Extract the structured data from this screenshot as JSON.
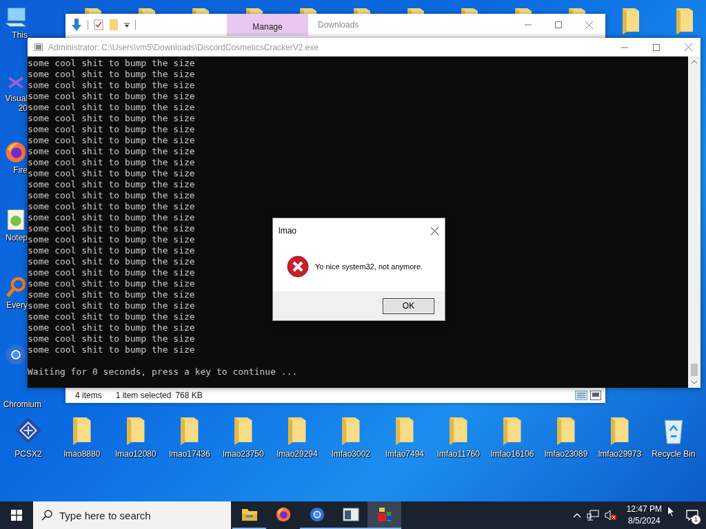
{
  "desktop": {
    "icons_top": [
      {
        "kind": "folder"
      },
      {
        "kind": "folder"
      },
      {
        "kind": "folder"
      },
      {
        "kind": "folder"
      },
      {
        "kind": "folder"
      },
      {
        "kind": "folder"
      },
      {
        "kind": "folder"
      },
      {
        "kind": "folder"
      },
      {
        "kind": "folder"
      },
      {
        "kind": "folder"
      },
      {
        "kind": "folder"
      },
      {
        "kind": "folder"
      }
    ],
    "icons_left": [
      {
        "kind": "computer",
        "label": "This"
      },
      {
        "kind": "visual-studio",
        "label": "Visual\n20"
      },
      {
        "kind": "firefox",
        "label": "Fire"
      },
      {
        "kind": "notepad",
        "label": "Notep"
      },
      {
        "kind": "everything",
        "label": "Every"
      },
      {
        "kind": "chromium",
        "label": "Chromium"
      }
    ],
    "icons_bottom": [
      {
        "kind": "pcsx2",
        "label": "PCSX2"
      },
      {
        "kind": "folder",
        "label": "lmao8880"
      },
      {
        "kind": "folder",
        "label": "lmao12080"
      },
      {
        "kind": "folder",
        "label": "lmao17436"
      },
      {
        "kind": "folder",
        "label": "lmao23750"
      },
      {
        "kind": "folder",
        "label": "lmao29294"
      },
      {
        "kind": "folder",
        "label": "lmfao3002"
      },
      {
        "kind": "folder",
        "label": "lmfao7494"
      },
      {
        "kind": "folder",
        "label": "lmfao11760"
      },
      {
        "kind": "folder",
        "label": "lmfao16106"
      },
      {
        "kind": "folder",
        "label": "lmfao23089"
      },
      {
        "kind": "folder",
        "label": "lmfao29973"
      },
      {
        "kind": "recycle-bin",
        "label": "Recycle Bin"
      }
    ]
  },
  "explorer": {
    "ribbon_tab": "Manage",
    "title": "Downloads",
    "status": {
      "items": "4 items",
      "selection": "1 item selected",
      "size": "768 KB"
    }
  },
  "console": {
    "title": "Administrator: C:\\Users\\vm5\\Downloads\\DiscordCosmeticsCrackerV2.exe",
    "lines": [
      "some cool shit to bump the size",
      "some cool shit to bump the size",
      "some cool shit to bump the size",
      "some cool shit to bump the size",
      "some cool shit to bump the size",
      "some cool shit to bump the size",
      "some cool shit to bump the size",
      "some cool shit to bump the size",
      "some cool shit to bump the size",
      "some cool shit to bump the size",
      "some cool shit to bump the size",
      "some cool shit to bump the size",
      "some cool shit to bump the size",
      "some cool shit to bump the size",
      "some cool shit to bump the size",
      "some cool shit to bump the size",
      "some cool shit to bump the size",
      "some cool shit to bump the size",
      "some cool shit to bump the size",
      "some cool shit to bump the size",
      "some cool shit to bump the size",
      "some cool shit to bump the size",
      "some cool shit to bump the size",
      "some cool shit to bump the size",
      "some cool shit to bump the size",
      "some cool shit to bump the size",
      "some cool shit to bump the size"
    ],
    "prompt": "Waiting for 0 seconds, press a key to continue ..."
  },
  "dialog": {
    "title": "lmao",
    "message": "Yo nice system32, not anymore.",
    "button": "OK"
  },
  "taskbar": {
    "search_placeholder": "Type here to search",
    "apps": [
      {
        "kind": "file-explorer",
        "running": true,
        "selected": false
      },
      {
        "kind": "firefox",
        "running": false,
        "selected": false
      },
      {
        "kind": "chromium",
        "running": true,
        "selected": false
      },
      {
        "kind": "window-app",
        "running": true,
        "selected": false
      },
      {
        "kind": "blocks-app",
        "running": true,
        "selected": true
      }
    ],
    "time": "12:47 PM",
    "date": "8/5/2024",
    "notification_count": "1"
  }
}
